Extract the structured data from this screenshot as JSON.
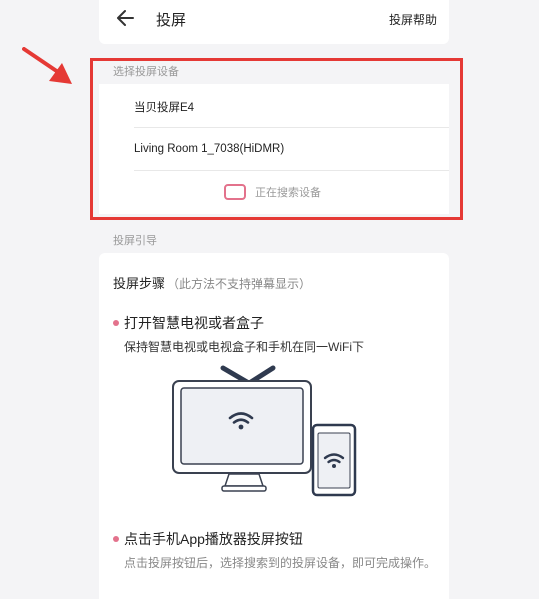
{
  "header": {
    "back_icon": "arrow-left-icon",
    "title": "投屏",
    "help_label": "投屏帮助"
  },
  "devices_section": {
    "label": "选择投屏设备",
    "items": [
      {
        "name": "当贝投屏E4"
      },
      {
        "name": "Living Room 1_7038(HiDMR)"
      }
    ],
    "searching_text": "正在搜索设备"
  },
  "guide_section": {
    "label": "投屏引导",
    "steps_title": "投屏步骤",
    "steps_note": "（此方法不支持弹幕显示）",
    "step1": {
      "title": "打开智慧电视或者盒子",
      "desc": "保持智慧电视或电视盒子和手机在同一WiFi下"
    },
    "step2": {
      "title": "点击手机App播放器投屏按钮",
      "desc": "点击投屏按钮后，选择搜索到的投屏设备，即可完成操作。"
    }
  },
  "colors": {
    "accent": "#e3728c",
    "annotation": "#e53935"
  }
}
